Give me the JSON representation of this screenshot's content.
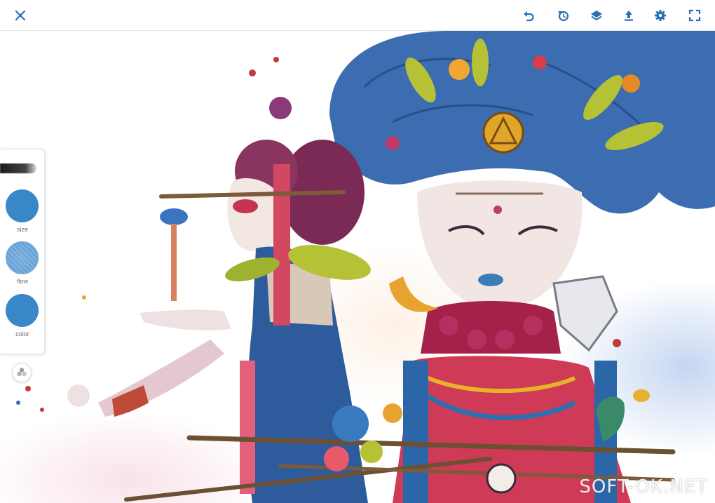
{
  "toolbar": {
    "icons": [
      "close-icon",
      "undo-icon",
      "redo-icon",
      "layers-icon",
      "export-icon",
      "settings-icon",
      "fullscreen-icon"
    ],
    "accent_color": "#2a6fb5"
  },
  "brush_panel": {
    "size_label": "size",
    "flow_label": "flow",
    "color_label": "color",
    "current_color": "#3a87c8"
  },
  "watermark": {
    "text": "SOFT-OK.NET"
  }
}
